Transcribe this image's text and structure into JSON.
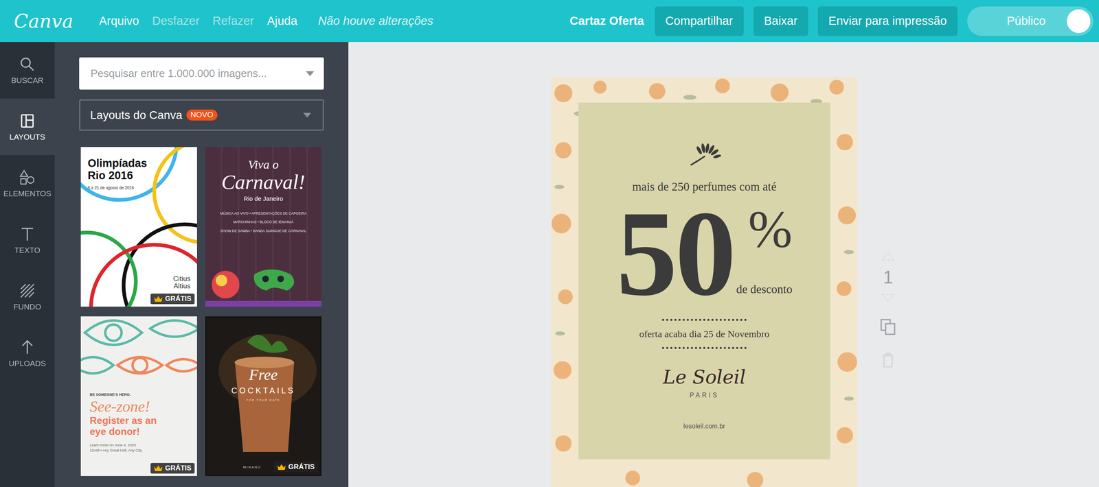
{
  "app": {
    "logo": "Canva"
  },
  "menu": [
    {
      "label": "Arquivo",
      "disabled": false
    },
    {
      "label": "Desfazer",
      "disabled": true
    },
    {
      "label": "Refazer",
      "disabled": true
    },
    {
      "label": "Ajuda",
      "disabled": false
    }
  ],
  "save_status": "Não houve alterações",
  "document_title": "Cartaz Oferta",
  "actions": [
    "Compartilhar",
    "Baixar",
    "Enviar para impressão"
  ],
  "visibility": {
    "label": "Público",
    "on": true
  },
  "sidebar": {
    "items": [
      {
        "label": "BUSCAR",
        "selected": false
      },
      {
        "label": "LAYOUTS",
        "selected": true
      },
      {
        "label": "ELEMENTOS",
        "selected": false
      },
      {
        "label": "TEXTO",
        "selected": false
      },
      {
        "label": "FUNDO",
        "selected": false
      },
      {
        "label": "UPLOADS",
        "selected": false
      }
    ]
  },
  "panel": {
    "search": {
      "placeholder": "Pesquisar entre 1.000.000 imagens..."
    },
    "dropdown": {
      "label": "Layouts do Canva",
      "badge": "NOVO"
    },
    "templates": [
      {
        "kind": "olympics",
        "lines": [
          "Olimpíadas",
          "Rio 2016",
          "5 a 21 de agosto de 2016",
          "Citius",
          "Altius"
        ],
        "badge": "GRÁTIS"
      },
      {
        "kind": "carnival",
        "lines": [
          "Viva o",
          "Carnaval!",
          "Rio de Janeiro",
          "MÚSICA AO VIVO • APRESENTAÇÕES DE CAPOEIRA",
          "MARCHINHAS • BLOCO DE IEMANJÁ",
          "SHOW DE SAMBA • BANDA SUINGUE DE CARNAVAL"
        ],
        "badge": null
      },
      {
        "kind": "eye",
        "lines": [
          "BE SOMEONE'S HERO.",
          "See-zone!",
          "Register as an",
          "eye donor!",
          "Learn more on June 4, 2020",
          "10AM • Any Great Hall, Any City"
        ],
        "badge": "GRÁTIS"
      },
      {
        "kind": "cocktail",
        "lines": [
          "Free",
          "COCKTAILS",
          "FOR YOUR DATE",
          "MIRANO"
        ],
        "badge": "GRÁTIS"
      }
    ]
  },
  "poster": {
    "headline": "mais de 250 perfumes com até",
    "value": "50",
    "unit": "%",
    "caption": "de desconto",
    "deadline": "oferta acaba dia 25 de Novembro",
    "brand": "Le Soleil",
    "city": "PARIS",
    "url": "lesoleil.com.br"
  },
  "page_controls": {
    "page": "1"
  }
}
